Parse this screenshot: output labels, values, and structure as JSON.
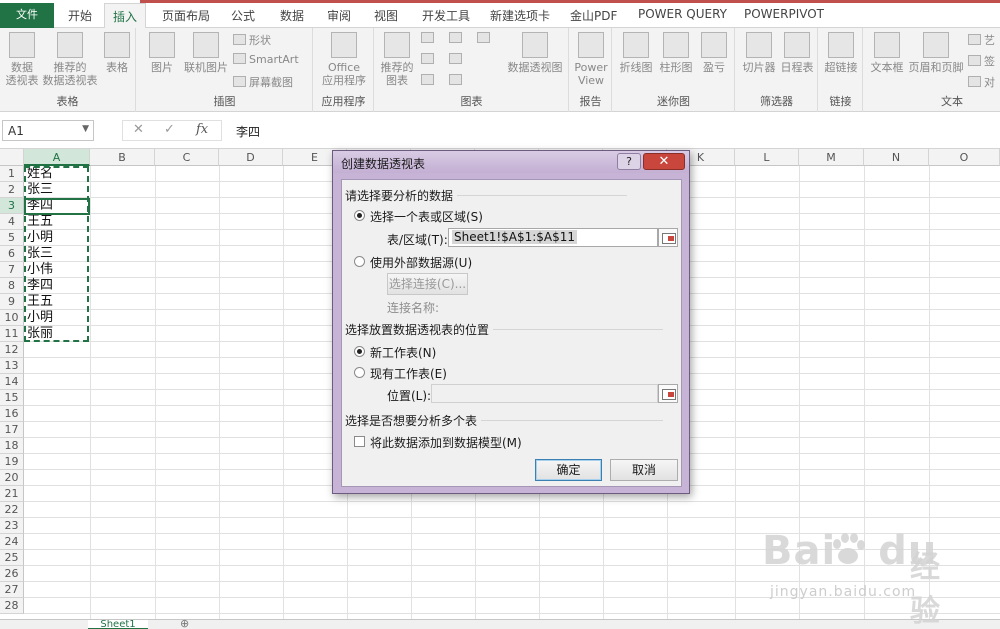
{
  "ribbon_tabs": [
    "文件",
    "开始",
    "插入",
    "页面布局",
    "公式",
    "数据",
    "审阅",
    "视图",
    "开发工具",
    "新建选项卡",
    "金山PDF",
    "POWER QUERY",
    "POWERPIVOT"
  ],
  "active_tab": "插入",
  "groups": {
    "tables": {
      "label": "表格",
      "pivot_l1": "数据",
      "pivot_l2": "透视表",
      "rec_l1": "推荐的",
      "rec_l2": "数据透视表",
      "table": "表格"
    },
    "illustrations": {
      "label": "插图",
      "picture": "图片",
      "online": "联机图片",
      "shapes": "形状",
      "smartart": "SmartArt",
      "screenshot": "屏幕截图"
    },
    "apps": {
      "label": "应用程序",
      "office_l1": "Office",
      "office_l2": "应用程序"
    },
    "charts": {
      "label": "图表",
      "rec_l1": "推荐的",
      "rec_l2": "图表",
      "pivotchart": "数据透视图"
    },
    "reports": {
      "label": "报告",
      "pv_l1": "Power",
      "pv_l2": "View"
    },
    "sparklines": {
      "label": "迷你图",
      "line": "折线图",
      "column": "柱形图",
      "winloss": "盈亏"
    },
    "filters": {
      "label": "筛选器",
      "slicer": "切片器",
      "timeline": "日程表"
    },
    "links": {
      "label": "链接",
      "hyperlink": "超链接"
    },
    "text": {
      "label": "文本",
      "textbox": "文本框",
      "headerfooter": "页眉和页脚",
      "art": "艺",
      "sig": "签",
      "obj": "对"
    }
  },
  "formula_bar": {
    "name_box": "A1",
    "cancel": "✕",
    "enter": "✓",
    "fx": "fx",
    "value": "李四"
  },
  "columns": [
    "A",
    "B",
    "C",
    "D",
    "E",
    "F",
    "G",
    "H",
    "I",
    "J",
    "K",
    "L",
    "M",
    "N",
    "O"
  ],
  "rows": [
    "1",
    "2",
    "3",
    "4",
    "5",
    "6",
    "7",
    "8",
    "9",
    "10",
    "11",
    "12",
    "13",
    "14",
    "15",
    "16",
    "17",
    "18",
    "19",
    "20",
    "21",
    "22",
    "23",
    "24",
    "25",
    "26",
    "27",
    "28"
  ],
  "cells": [
    "姓名",
    "张三",
    "李四",
    "王五",
    "小明",
    "张三",
    "小伟",
    "李四",
    "王五",
    "小明",
    "张丽"
  ],
  "sheet": {
    "tab": "Sheet1",
    "add": "⊕"
  },
  "watermark": {
    "brand": "Bai",
    "brand2": "du",
    "cn": "经验",
    "url": "jingyan.baidu.com"
  },
  "dialog": {
    "title": "创建数据透视表",
    "help": "?",
    "close": "✕",
    "section1": "请选择要分析的数据",
    "opt_range": "选择一个表或区域(S)",
    "range_label": "表/区域(T):",
    "range_value": "Sheet1!$A$1:$A$11",
    "opt_external": "使用外部数据源(U)",
    "choose_conn": "选择连接(C)...",
    "conn_name": "连接名称:",
    "section2": "选择放置数据透视表的位置",
    "opt_new": "新工作表(N)",
    "opt_existing": "现有工作表(E)",
    "location_label": "位置(L):",
    "section3": "选择是否想要分析多个表",
    "add_model": "将此数据添加到数据模型(M)",
    "ok": "确定",
    "cancel": "取消"
  },
  "colors": {
    "excel_green": "#217346",
    "dialog_frame": "#c6b3d6",
    "close_red": "#c9463d"
  }
}
